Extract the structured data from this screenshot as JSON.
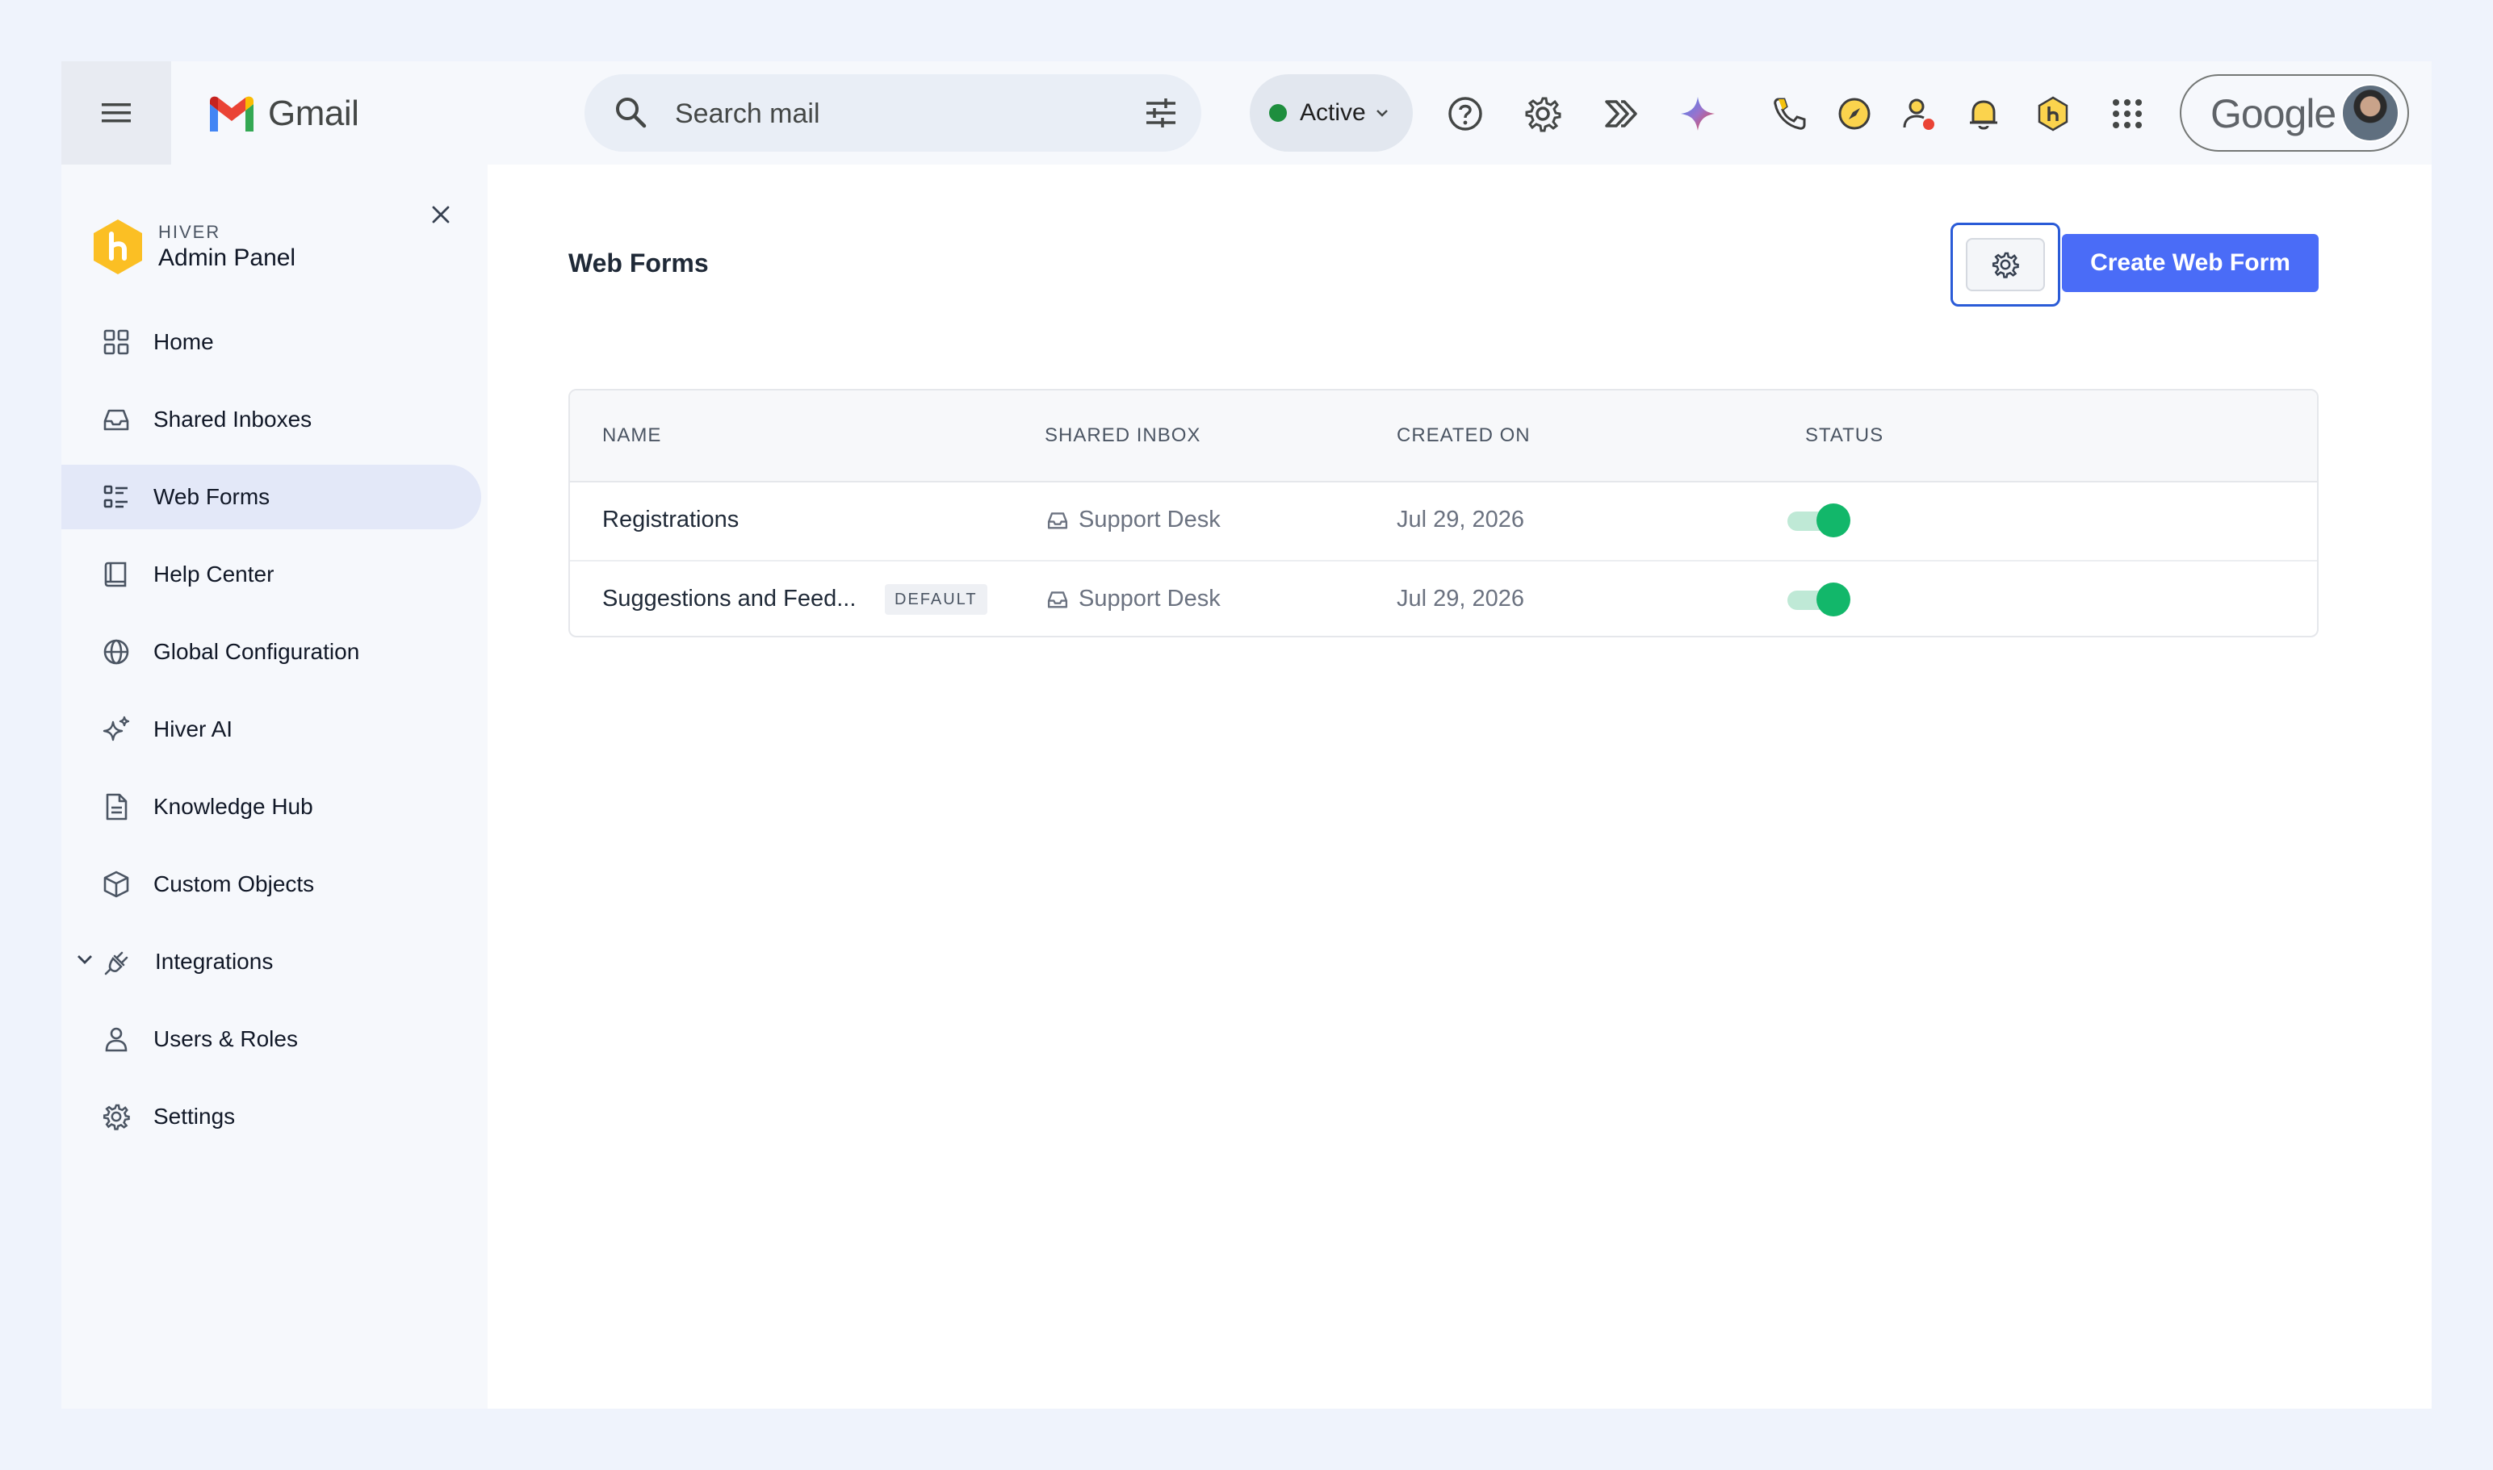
{
  "gmail": {
    "app_name": "Gmail",
    "search_placeholder": "Search mail",
    "status_label": "Active",
    "account_label": "Google"
  },
  "sidebar": {
    "brand_small": "HIVER",
    "brand_big": "Admin Panel",
    "items": [
      {
        "label": "Home"
      },
      {
        "label": "Shared Inboxes"
      },
      {
        "label": "Web Forms"
      },
      {
        "label": "Help Center"
      },
      {
        "label": "Global Configuration"
      },
      {
        "label": "Hiver AI"
      },
      {
        "label": "Knowledge Hub"
      },
      {
        "label": "Custom Objects"
      },
      {
        "label": "Integrations"
      },
      {
        "label": "Users & Roles"
      },
      {
        "label": "Settings"
      }
    ],
    "active_item": "Web Forms"
  },
  "main": {
    "title": "Web Forms",
    "create_button": "Create Web Form",
    "columns": [
      "NAME",
      "SHARED INBOX",
      "CREATED ON",
      "STATUS"
    ],
    "rows": [
      {
        "name": "Registrations",
        "badge": "",
        "inbox": "Support Desk",
        "created": "Jul 29, 2026",
        "enabled": true
      },
      {
        "name": "Suggestions and Feed...",
        "badge": "DEFAULT",
        "inbox": "Support Desk",
        "created": "Jul 29, 2026",
        "enabled": true
      }
    ]
  },
  "colors": {
    "accent": "#4a6cf7",
    "toggle_on": "#12b76a",
    "active_nav_bg": "#e3e8f8",
    "status_dot": "#1e8e3e"
  }
}
